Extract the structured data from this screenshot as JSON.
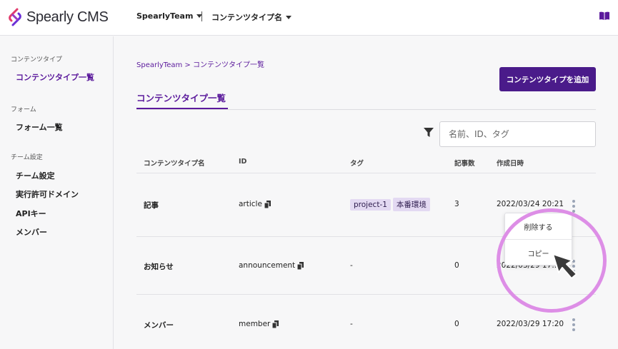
{
  "header": {
    "logo_text": "Spearly CMS",
    "team": "SpearlyTeam",
    "content_type": "コンテンツタイプ名",
    "book_icon": "book-icon"
  },
  "sidebar": {
    "groups": [
      {
        "label": "コンテンツタイプ",
        "items": [
          {
            "label": "コンテンツタイプ一覧",
            "active": true
          }
        ]
      },
      {
        "label": "フォーム",
        "items": [
          {
            "label": "フォーム一覧"
          }
        ]
      },
      {
        "label": "チーム設定",
        "items": [
          {
            "label": "チーム設定"
          },
          {
            "label": "実行許可ドメイン"
          },
          {
            "label": "APIキー"
          },
          {
            "label": "メンバー"
          }
        ]
      }
    ]
  },
  "main": {
    "breadcrumb": "SpearlyTeam > コンテンツタイプ一覧",
    "add_button": "コンテンツタイプを追加",
    "tab": "コンテンツタイプ一覧",
    "search_placeholder": "名前、ID、タグ",
    "columns": [
      "コンテンツタイプ名",
      "ID",
      "タグ",
      "記事数",
      "作成日時"
    ],
    "rows": [
      {
        "name": "記事",
        "id": "article",
        "tags": [
          "project-1",
          "本番環境"
        ],
        "count": "3",
        "created": "2022/03/24 20:21"
      },
      {
        "name": "お知らせ",
        "id": "announcement",
        "tags_text": "-",
        "count": "0",
        "created": "2022/03/29 17:..."
      },
      {
        "name": "メンバー",
        "id": "member",
        "tags_text": "-",
        "count": "0",
        "created": "2022/03/29 17:20"
      }
    ]
  },
  "menu": {
    "delete": "削除する",
    "copy": "コピー"
  },
  "colors": {
    "brand": "#4a1b8a",
    "link": "#5b1a9c",
    "tag_bg": "#e3d9f2",
    "highlight": "#dd8ee6"
  }
}
